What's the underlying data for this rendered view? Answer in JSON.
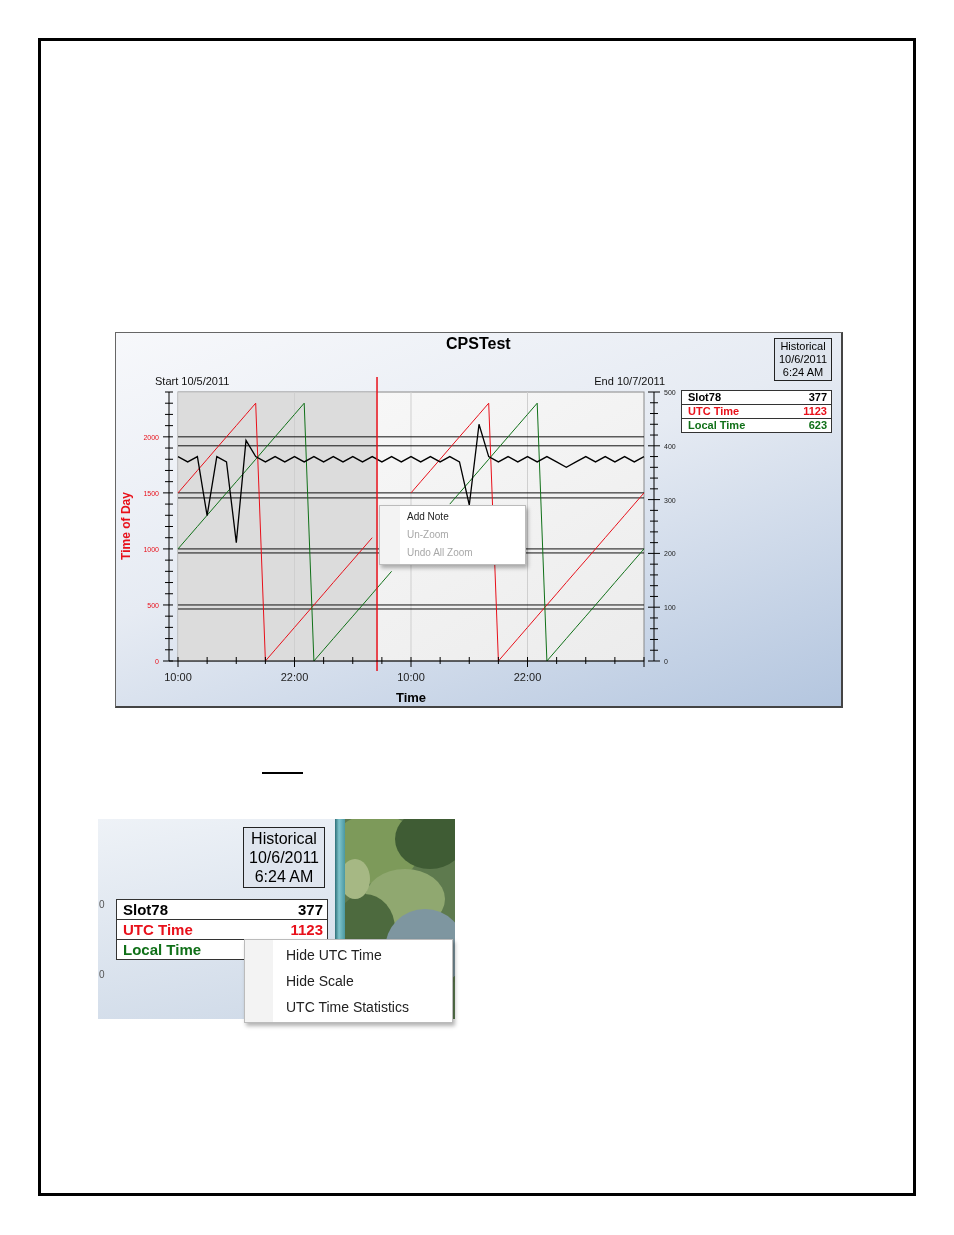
{
  "chart_window": {
    "title": "CPSTest",
    "start_label": "Start 10/5/2011",
    "end_label": "End 10/7/2011",
    "mode_box": [
      "Historical",
      "10/6/2011",
      "6:24 AM"
    ],
    "legend_values": [
      "377",
      "1123",
      "623"
    ],
    "chart_data": {
      "type": "line",
      "xlabel": "Time",
      "ylabel": "Time of Day",
      "categories": [
        "10:00",
        null,
        null,
        null,
        null,
        null,
        null,
        null,
        null,
        null,
        null,
        null,
        "22:00",
        null,
        null,
        null,
        null,
        null,
        null,
        null,
        null,
        null,
        null,
        null,
        "10:00",
        null,
        null,
        null,
        null,
        null,
        null,
        null,
        null,
        null,
        null,
        null,
        "22:00",
        null,
        null,
        null,
        null,
        null,
        null,
        null,
        null,
        null,
        null,
        null,
        null
      ],
      "ylim": [
        0,
        2400
      ],
      "yticks": [
        0,
        500,
        1000,
        1500,
        2000
      ],
      "y2lim": [
        0,
        500
      ],
      "y2ticks": [
        0,
        100,
        200,
        300,
        400,
        500
      ],
      "series": [
        {
          "name": "Slot78",
          "color": "#000000",
          "axis": "y2",
          "values": [
            380,
            370,
            380,
            270,
            380,
            370,
            220,
            410,
            380,
            370,
            380,
            370,
            380,
            370,
            380,
            370,
            380,
            370,
            380,
            370,
            380,
            370,
            380,
            370,
            380,
            370,
            380,
            370,
            380,
            370,
            290,
            440,
            380,
            370,
            380,
            370,
            380,
            370,
            380,
            370,
            360,
            370,
            380,
            370,
            380,
            370,
            380,
            370,
            380
          ]
        },
        {
          "name": "UTC Time",
          "color": "#e8101a",
          "values": [
            1500,
            1600,
            1700,
            1800,
            1900,
            2000,
            2100,
            2200,
            2300,
            0,
            100,
            200,
            300,
            400,
            500,
            600,
            700,
            800,
            900,
            1000,
            1100,
            null,
            null,
            null,
            1500,
            1600,
            1700,
            1800,
            1900,
            2000,
            2100,
            2200,
            2300,
            0,
            100,
            200,
            300,
            400,
            500,
            600,
            700,
            800,
            900,
            1000,
            1100,
            1200,
            1300,
            1400,
            1500
          ]
        },
        {
          "name": "Local Time",
          "color": "#107018",
          "values": [
            1000,
            1100,
            1200,
            1300,
            1400,
            1500,
            1600,
            1700,
            1800,
            1900,
            2000,
            2100,
            2200,
            2300,
            0,
            100,
            200,
            300,
            400,
            500,
            600,
            700,
            800,
            null,
            null,
            null,
            null,
            null,
            1400,
            1500,
            1600,
            1700,
            1800,
            1900,
            2000,
            2100,
            2200,
            2300,
            0,
            100,
            200,
            300,
            400,
            500,
            600,
            700,
            800,
            900,
            1000
          ]
        }
      ],
      "grid": true,
      "ref_lines": [
        {
          "axis": "y",
          "value": 2000
        },
        {
          "axis": "y",
          "value": 1920
        },
        {
          "axis": "y",
          "value": 1500
        },
        {
          "axis": "y",
          "value": 1455
        },
        {
          "axis": "y",
          "value": 1000
        },
        {
          "axis": "y",
          "value": 964
        },
        {
          "axis": "y",
          "value": 500
        },
        {
          "axis": "y",
          "value": 464
        }
      ]
    },
    "context_menu": [
      {
        "label": "Add Note",
        "disabled": false
      },
      {
        "label": "Un-Zoom",
        "disabled": true
      },
      {
        "label": "Undo All Zoom",
        "disabled": true
      }
    ]
  },
  "legend_closeup": {
    "axis_fragments": [
      "0",
      "0"
    ],
    "mode_box": [
      "Historical",
      "10/6/2011",
      "6:24 AM"
    ],
    "legend": [
      {
        "name": "Slot78",
        "value": "377",
        "color": "#000000"
      },
      {
        "name": "UTC Time",
        "value": "1123",
        "color": "#e8101a"
      },
      {
        "name": "Local Time",
        "color": "#107018"
      }
    ],
    "context_menu": [
      {
        "label": "Hide UTC Time",
        "disabled": false
      },
      {
        "label": "Hide Scale",
        "disabled": false
      },
      {
        "label": "UTC Time Statistics",
        "disabled": false
      }
    ],
    "picture": {
      "kind": "picture"
    }
  }
}
